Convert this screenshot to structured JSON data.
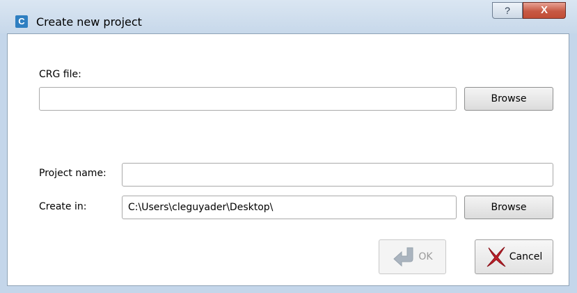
{
  "window": {
    "title": "Create new project",
    "app_icon_letter": "C",
    "help_glyph": "?",
    "close_glyph": "X"
  },
  "crg": {
    "label": "CRG file:",
    "value": "",
    "browse_label": "Browse"
  },
  "project": {
    "name_label": "Project name:",
    "name_value": "",
    "create_in_label": "Create in:",
    "create_in_value": "C:\\Users\\cleguyader\\Desktop\\",
    "browse_label": "Browse"
  },
  "actions": {
    "ok_label": "OK",
    "ok_enabled": false,
    "cancel_label": "Cancel"
  },
  "colors": {
    "frame": "#c4d6ea",
    "close_button": "#c75944",
    "app_icon": "#2f7fc1",
    "cancel_icon": "#c0202a",
    "ok_icon_disabled": "#aab4bf"
  }
}
